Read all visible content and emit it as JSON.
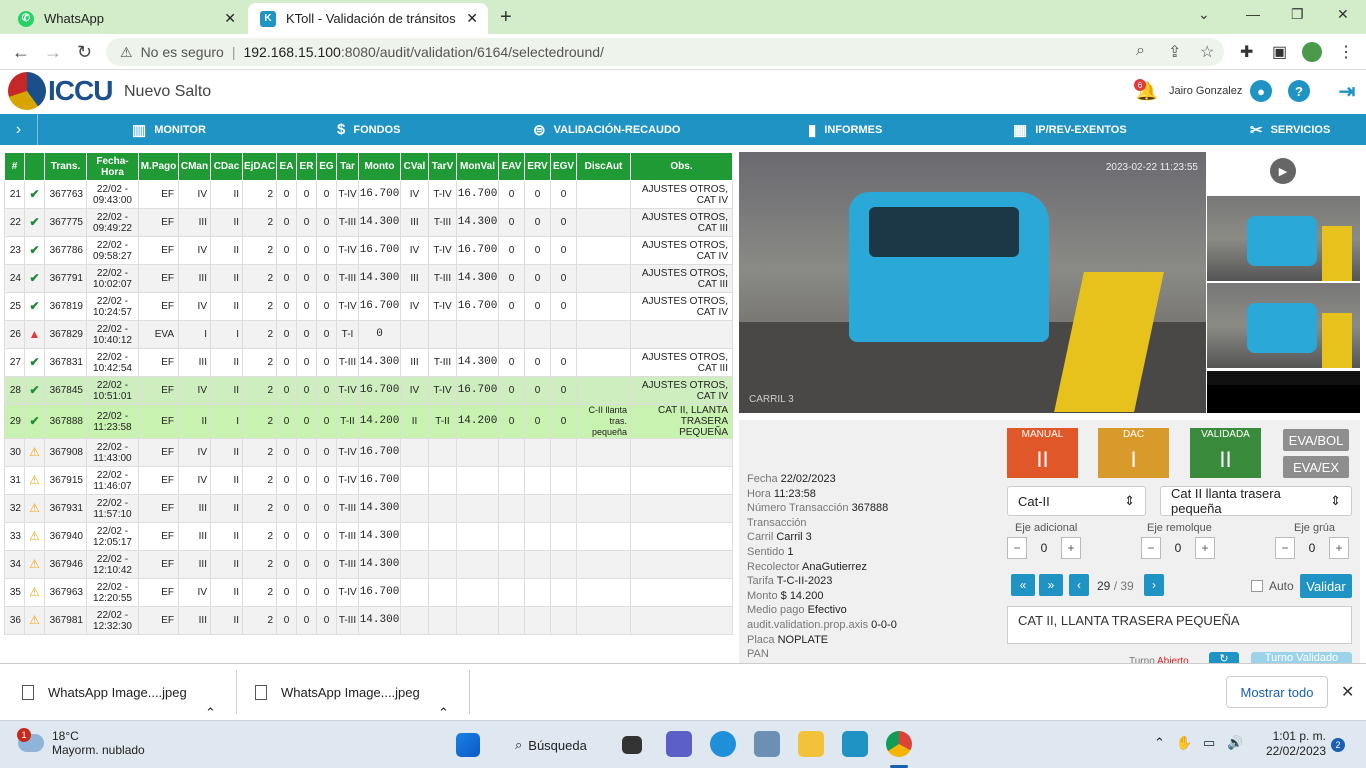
{
  "browser": {
    "tabs": [
      {
        "title": "WhatsApp",
        "icon": "whatsapp-icon"
      },
      {
        "title": "KToll - Validación de tránsitos",
        "icon": "ktoll-icon"
      }
    ],
    "security": "No es seguro",
    "url_host": "192.168.15.100",
    "url_rest": ":8080/audit/validation/6164/selectedround/"
  },
  "app": {
    "logo_text": "ICCU",
    "site": "Nuevo Salto",
    "notifications": "6",
    "user": "Jairo Gonzalez",
    "menu": [
      {
        "label": "MONITOR",
        "icon": "monitor-icon"
      },
      {
        "label": "FONDOS",
        "icon": "money-bag-icon"
      },
      {
        "label": "VALIDACIÓN-RECAUDO",
        "icon": "search-money-icon"
      },
      {
        "label": "INFORMES",
        "icon": "bar-chart-icon"
      },
      {
        "label": "IP/REV-EXENTOS",
        "icon": "chip-icon"
      },
      {
        "label": "SERVICIOS",
        "icon": "tools-icon"
      }
    ]
  },
  "table": {
    "headers": [
      "#",
      "",
      "Trans.",
      "Fecha-Hora",
      "M.Pago",
      "CMan",
      "CDac",
      "EjDAC",
      "EA",
      "ER",
      "EG",
      "Tar",
      "Monto",
      "CVal",
      "TarV",
      "MonVal",
      "EAV",
      "ERV",
      "EGV",
      "DiscAut",
      "Obs."
    ],
    "rows": [
      {
        "n": "21",
        "st": "ok",
        "trans": "367763",
        "fecha": "22/02 -",
        "hora": "09:43:00",
        "mp": "EF",
        "cman": "IV",
        "cdac": "II",
        "ej": "2",
        "ea": "0",
        "er": "0",
        "eg": "0",
        "tar": "T-IV",
        "monto": "16.700",
        "cval": "IV",
        "tarv": "T-IV",
        "monval": "16.700",
        "eav": "0",
        "erv": "0",
        "egv": "0",
        "disc": "",
        "obs": "AJUSTES OTROS, CAT IV",
        "cls": ""
      },
      {
        "n": "22",
        "st": "ok",
        "trans": "367775",
        "fecha": "22/02 -",
        "hora": "09:49:22",
        "mp": "EF",
        "cman": "III",
        "cdac": "II",
        "ej": "2",
        "ea": "0",
        "er": "0",
        "eg": "0",
        "tar": "T-III",
        "monto": "14.300",
        "cval": "III",
        "tarv": "T-III",
        "monval": "14.300",
        "eav": "0",
        "erv": "0",
        "egv": "0",
        "disc": "",
        "obs": "AJUSTES OTROS, CAT III",
        "cls": "g"
      },
      {
        "n": "23",
        "st": "ok",
        "trans": "367786",
        "fecha": "22/02 -",
        "hora": "09:58:27",
        "mp": "EF",
        "cman": "IV",
        "cdac": "II",
        "ej": "2",
        "ea": "0",
        "er": "0",
        "eg": "0",
        "tar": "T-IV",
        "monto": "16.700",
        "cval": "IV",
        "tarv": "T-IV",
        "monval": "16.700",
        "eav": "0",
        "erv": "0",
        "egv": "0",
        "disc": "",
        "obs": "AJUSTES OTROS, CAT IV",
        "cls": ""
      },
      {
        "n": "24",
        "st": "ok",
        "trans": "367791",
        "fecha": "22/02 -",
        "hora": "10:02:07",
        "mp": "EF",
        "cman": "III",
        "cdac": "II",
        "ej": "2",
        "ea": "0",
        "er": "0",
        "eg": "0",
        "tar": "T-III",
        "monto": "14.300",
        "cval": "III",
        "tarv": "T-III",
        "monval": "14.300",
        "eav": "0",
        "erv": "0",
        "egv": "0",
        "disc": "",
        "obs": "AJUSTES OTROS, CAT III",
        "cls": "g"
      },
      {
        "n": "25",
        "st": "ok",
        "trans": "367819",
        "fecha": "22/02 -",
        "hora": "10:24:57",
        "mp": "EF",
        "cman": "IV",
        "cdac": "II",
        "ej": "2",
        "ea": "0",
        "er": "0",
        "eg": "0",
        "tar": "T-IV",
        "monto": "16.700",
        "cval": "IV",
        "tarv": "T-IV",
        "monval": "16.700",
        "eav": "0",
        "erv": "0",
        "egv": "0",
        "disc": "",
        "obs": "AJUSTES OTROS, CAT IV",
        "cls": ""
      },
      {
        "n": "26",
        "st": "alert",
        "trans": "367829",
        "fecha": "22/02 -",
        "hora": "10:40:12",
        "mp": "EVA",
        "cman": "I",
        "cdac": "I",
        "ej": "2",
        "ea": "0",
        "er": "0",
        "eg": "0",
        "tar": "T-I",
        "monto": "0",
        "cval": "",
        "tarv": "",
        "monval": "",
        "eav": "",
        "erv": "",
        "egv": "",
        "disc": "",
        "obs": "",
        "cls": "g"
      },
      {
        "n": "27",
        "st": "ok",
        "trans": "367831",
        "fecha": "22/02 -",
        "hora": "10:42:54",
        "mp": "EF",
        "cman": "III",
        "cdac": "II",
        "ej": "2",
        "ea": "0",
        "er": "0",
        "eg": "0",
        "tar": "T-III",
        "monto": "14.300",
        "cval": "III",
        "tarv": "T-III",
        "monval": "14.300",
        "eav": "0",
        "erv": "0",
        "egv": "0",
        "disc": "",
        "obs": "AJUSTES OTROS, CAT III",
        "cls": ""
      },
      {
        "n": "28",
        "st": "ok",
        "trans": "367845",
        "fecha": "22/02 -",
        "hora": "10:51:01",
        "mp": "EF",
        "cman": "IV",
        "cdac": "II",
        "ej": "2",
        "ea": "0",
        "er": "0",
        "eg": "0",
        "tar": "T-IV",
        "monto": "16.700",
        "cval": "IV",
        "tarv": "T-IV",
        "monval": "16.700",
        "eav": "0",
        "erv": "0",
        "egv": "0",
        "disc": "",
        "obs": "AJUSTES OTROS, CAT IV",
        "cls": "hl"
      },
      {
        "n": "29",
        "st": "ok",
        "trans": "367888",
        "fecha": "22/02 -",
        "hora": "11:23:58",
        "mp": "EF",
        "cman": "II",
        "cdac": "I",
        "ej": "2",
        "ea": "0",
        "er": "0",
        "eg": "0",
        "tar": "T-II",
        "monto": "14.200",
        "cval": "II",
        "tarv": "T-II",
        "monval": "14.200",
        "eav": "0",
        "erv": "0",
        "egv": "0",
        "disc": "C-II llanta tras. pequeña",
        "obs": "CAT II, LLANTA TRASERA PEQUEÑA",
        "cls": "sel"
      },
      {
        "n": "30",
        "st": "warn",
        "trans": "367908",
        "fecha": "22/02 -",
        "hora": "11:43:00",
        "mp": "EF",
        "cman": "IV",
        "cdac": "II",
        "ej": "2",
        "ea": "0",
        "er": "0",
        "eg": "0",
        "tar": "T-IV",
        "monto": "16.700",
        "cval": "",
        "tarv": "",
        "monval": "",
        "eav": "",
        "erv": "",
        "egv": "",
        "disc": "",
        "obs": "",
        "cls": "g"
      },
      {
        "n": "31",
        "st": "warn",
        "trans": "367915",
        "fecha": "22/02 -",
        "hora": "11:46:07",
        "mp": "EF",
        "cman": "IV",
        "cdac": "II",
        "ej": "2",
        "ea": "0",
        "er": "0",
        "eg": "0",
        "tar": "T-IV",
        "monto": "16.700",
        "cval": "",
        "tarv": "",
        "monval": "",
        "eav": "",
        "erv": "",
        "egv": "",
        "disc": "",
        "obs": "",
        "cls": ""
      },
      {
        "n": "32",
        "st": "warn",
        "trans": "367931",
        "fecha": "22/02 -",
        "hora": "11:57:10",
        "mp": "EF",
        "cman": "III",
        "cdac": "II",
        "ej": "2",
        "ea": "0",
        "er": "0",
        "eg": "0",
        "tar": "T-III",
        "monto": "14.300",
        "cval": "",
        "tarv": "",
        "monval": "",
        "eav": "",
        "erv": "",
        "egv": "",
        "disc": "",
        "obs": "",
        "cls": "g"
      },
      {
        "n": "33",
        "st": "warn",
        "trans": "367940",
        "fecha": "22/02 -",
        "hora": "12:05:17",
        "mp": "EF",
        "cman": "III",
        "cdac": "II",
        "ej": "2",
        "ea": "0",
        "er": "0",
        "eg": "0",
        "tar": "T-III",
        "monto": "14.300",
        "cval": "",
        "tarv": "",
        "monval": "",
        "eav": "",
        "erv": "",
        "egv": "",
        "disc": "",
        "obs": "",
        "cls": ""
      },
      {
        "n": "34",
        "st": "warn",
        "trans": "367946",
        "fecha": "22/02 -",
        "hora": "12:10:42",
        "mp": "EF",
        "cman": "III",
        "cdac": "II",
        "ej": "2",
        "ea": "0",
        "er": "0",
        "eg": "0",
        "tar": "T-III",
        "monto": "14.300",
        "cval": "",
        "tarv": "",
        "monval": "",
        "eav": "",
        "erv": "",
        "egv": "",
        "disc": "",
        "obs": "",
        "cls": "g"
      },
      {
        "n": "35",
        "st": "warn",
        "trans": "367963",
        "fecha": "22/02 -",
        "hora": "12:20:55",
        "mp": "EF",
        "cman": "IV",
        "cdac": "II",
        "ej": "2",
        "ea": "0",
        "er": "0",
        "eg": "0",
        "tar": "T-IV",
        "monto": "16.700",
        "cval": "",
        "tarv": "",
        "monval": "",
        "eav": "",
        "erv": "",
        "egv": "",
        "disc": "",
        "obs": "",
        "cls": ""
      },
      {
        "n": "36",
        "st": "warn",
        "trans": "367981",
        "fecha": "22/02 -",
        "hora": "12:32:30",
        "mp": "EF",
        "cman": "III",
        "cdac": "II",
        "ej": "2",
        "ea": "0",
        "er": "0",
        "eg": "0",
        "tar": "T-III",
        "monto": "14.300",
        "cval": "",
        "tarv": "",
        "monval": "",
        "eav": "",
        "erv": "",
        "egv": "",
        "disc": "",
        "obs": "",
        "cls": "g"
      }
    ]
  },
  "camera": {
    "timestamp": "2023-02-22 11:23:55",
    "lane": "CARRIL 3"
  },
  "detail": {
    "fecha_l": "Fecha",
    "fecha": "22/02/2023",
    "hora_l": "Hora",
    "hora": "11:23:58",
    "num_l": "Número Transacción",
    "num": "367888",
    "trans_l": "Transacción",
    "carril_l": "Carril",
    "carril": "Carril 3",
    "sentido_l": "Sentido",
    "sentido": "1",
    "recolector_l": "Recolector",
    "recolector": "AnaGutierrez",
    "tarifa_l": "Tarifa",
    "tarifa": "T-C-II-2023",
    "monto_l": "Monto",
    "monto": "$ 14.200",
    "medio_l": "Medio pago",
    "medio": "Efectivo",
    "axis_l": "audit.validation.prop.axis",
    "axis": "0-0-0",
    "placa_l": "Placa",
    "placa": "NOPLATE",
    "pan_l": "PAN"
  },
  "validation": {
    "manual_l": "MANUAL",
    "manual": "II",
    "manual_color": "#e0582a",
    "dac_l": "DAC",
    "dac": "I",
    "dac_color": "#d89a2a",
    "validada_l": "VALIDADA",
    "validada": "II",
    "validada_color": "#3a8a3c",
    "eva_bol": "EVA/BOL",
    "eva_ex": "EVA/EX",
    "cat_select": "Cat-II",
    "disc_select": "Cat II llanta trasera pequeña",
    "eje_adicional_l": "Eje adicional",
    "eje_adicional": "0",
    "eje_remolque_l": "Eje remolque",
    "eje_remolque": "0",
    "eje_grua_l": "Eje grúa",
    "eje_grua": "0",
    "page_current": "29",
    "page_total": "/ 39",
    "auto_l": "Auto",
    "validar": "Validar",
    "obs": "CAT II, LLANTA TRASERA PEQUEÑA",
    "turno_l": "Turno",
    "turno": "Abierto",
    "turno_validado": "Turno Validado"
  },
  "downloads": {
    "items": [
      "WhatsApp Image....jpeg",
      "WhatsApp Image....jpeg"
    ],
    "show_all": "Mostrar todo"
  },
  "taskbar": {
    "weather_temp": "18°C",
    "weather_desc": "Mayorm. nublado",
    "weather_badge": "1",
    "search": "Búsqueda",
    "time": "1:01 p. m.",
    "date": "22/02/2023",
    "notif": "2"
  }
}
